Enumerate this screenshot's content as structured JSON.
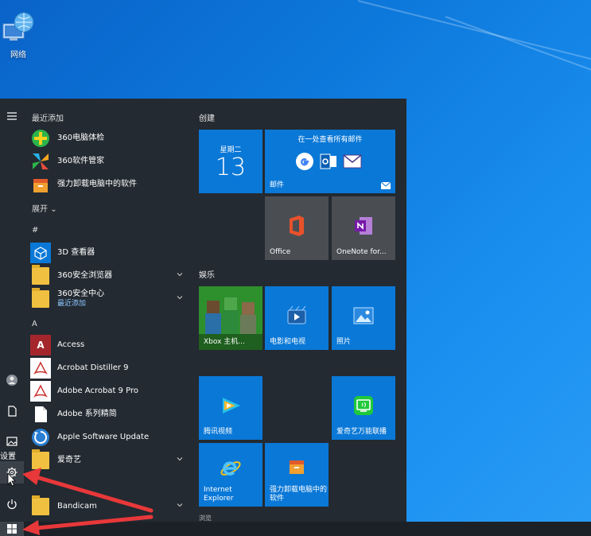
{
  "desktop": {
    "network_label": "网络"
  },
  "start_menu": {
    "rail": {
      "settings_label": "设置"
    },
    "apps": {
      "recent_header": "最近添加",
      "recent": [
        {
          "label": "360电脑体检",
          "icon": "360-checkup-icon"
        },
        {
          "label": "360软件管家",
          "icon": "360-software-manager-icon"
        },
        {
          "label": "强力卸载电脑中的软件",
          "icon": "uninstaller-icon"
        }
      ],
      "expand_label": "展开",
      "hash_header": "#",
      "hash_items": [
        {
          "label": "3D 查看器",
          "icon": "3d-viewer-icon"
        },
        {
          "label": "360安全浏览器",
          "icon": "folder-icon",
          "expandable": true
        },
        {
          "label": "360安全中心",
          "sub": "最近添加",
          "icon": "folder-icon",
          "expandable": true
        }
      ],
      "a_header": "A",
      "a_items": [
        {
          "label": "Access",
          "icon": "access-icon"
        },
        {
          "label": "Acrobat Distiller 9",
          "icon": "acrobat-distiller-icon"
        },
        {
          "label": "Adobe Acrobat 9 Pro",
          "icon": "adobe-acrobat-icon"
        },
        {
          "label": "Adobe 系列精简",
          "icon": "document-icon"
        },
        {
          "label": "Apple Software Update",
          "icon": "apple-update-icon"
        },
        {
          "label": "爱奇艺",
          "icon": "folder-icon",
          "expandable": true
        }
      ],
      "b_items": [
        {
          "label": "Bandicam",
          "icon": "folder-icon",
          "expandable": true
        }
      ]
    },
    "tiles": {
      "group_create": "创建",
      "calendar": {
        "weekday": "星期二",
        "day": "13"
      },
      "mail": {
        "header": "在一处查看所有邮件",
        "label": "邮件"
      },
      "office": {
        "label": "Office"
      },
      "onenote": {
        "label": "OneNote for..."
      },
      "group_entertainment": "娱乐",
      "xbox": {
        "label": "Xbox 主机..."
      },
      "movies": {
        "label": "电影和电视"
      },
      "photos": {
        "label": "照片"
      },
      "tencent_video": {
        "label": "腾讯视频"
      },
      "iqiyi_link": {
        "label": "爱奇艺万能联播"
      },
      "ie": {
        "label": "Internet Explorer"
      },
      "uninstall": {
        "label": "强力卸载电脑中的软件"
      },
      "partial_group": "浏览"
    }
  },
  "colors": {
    "accent": "#0a78d7",
    "menu_bg": "#232a31",
    "annotation_arrow": "#e8383a"
  }
}
